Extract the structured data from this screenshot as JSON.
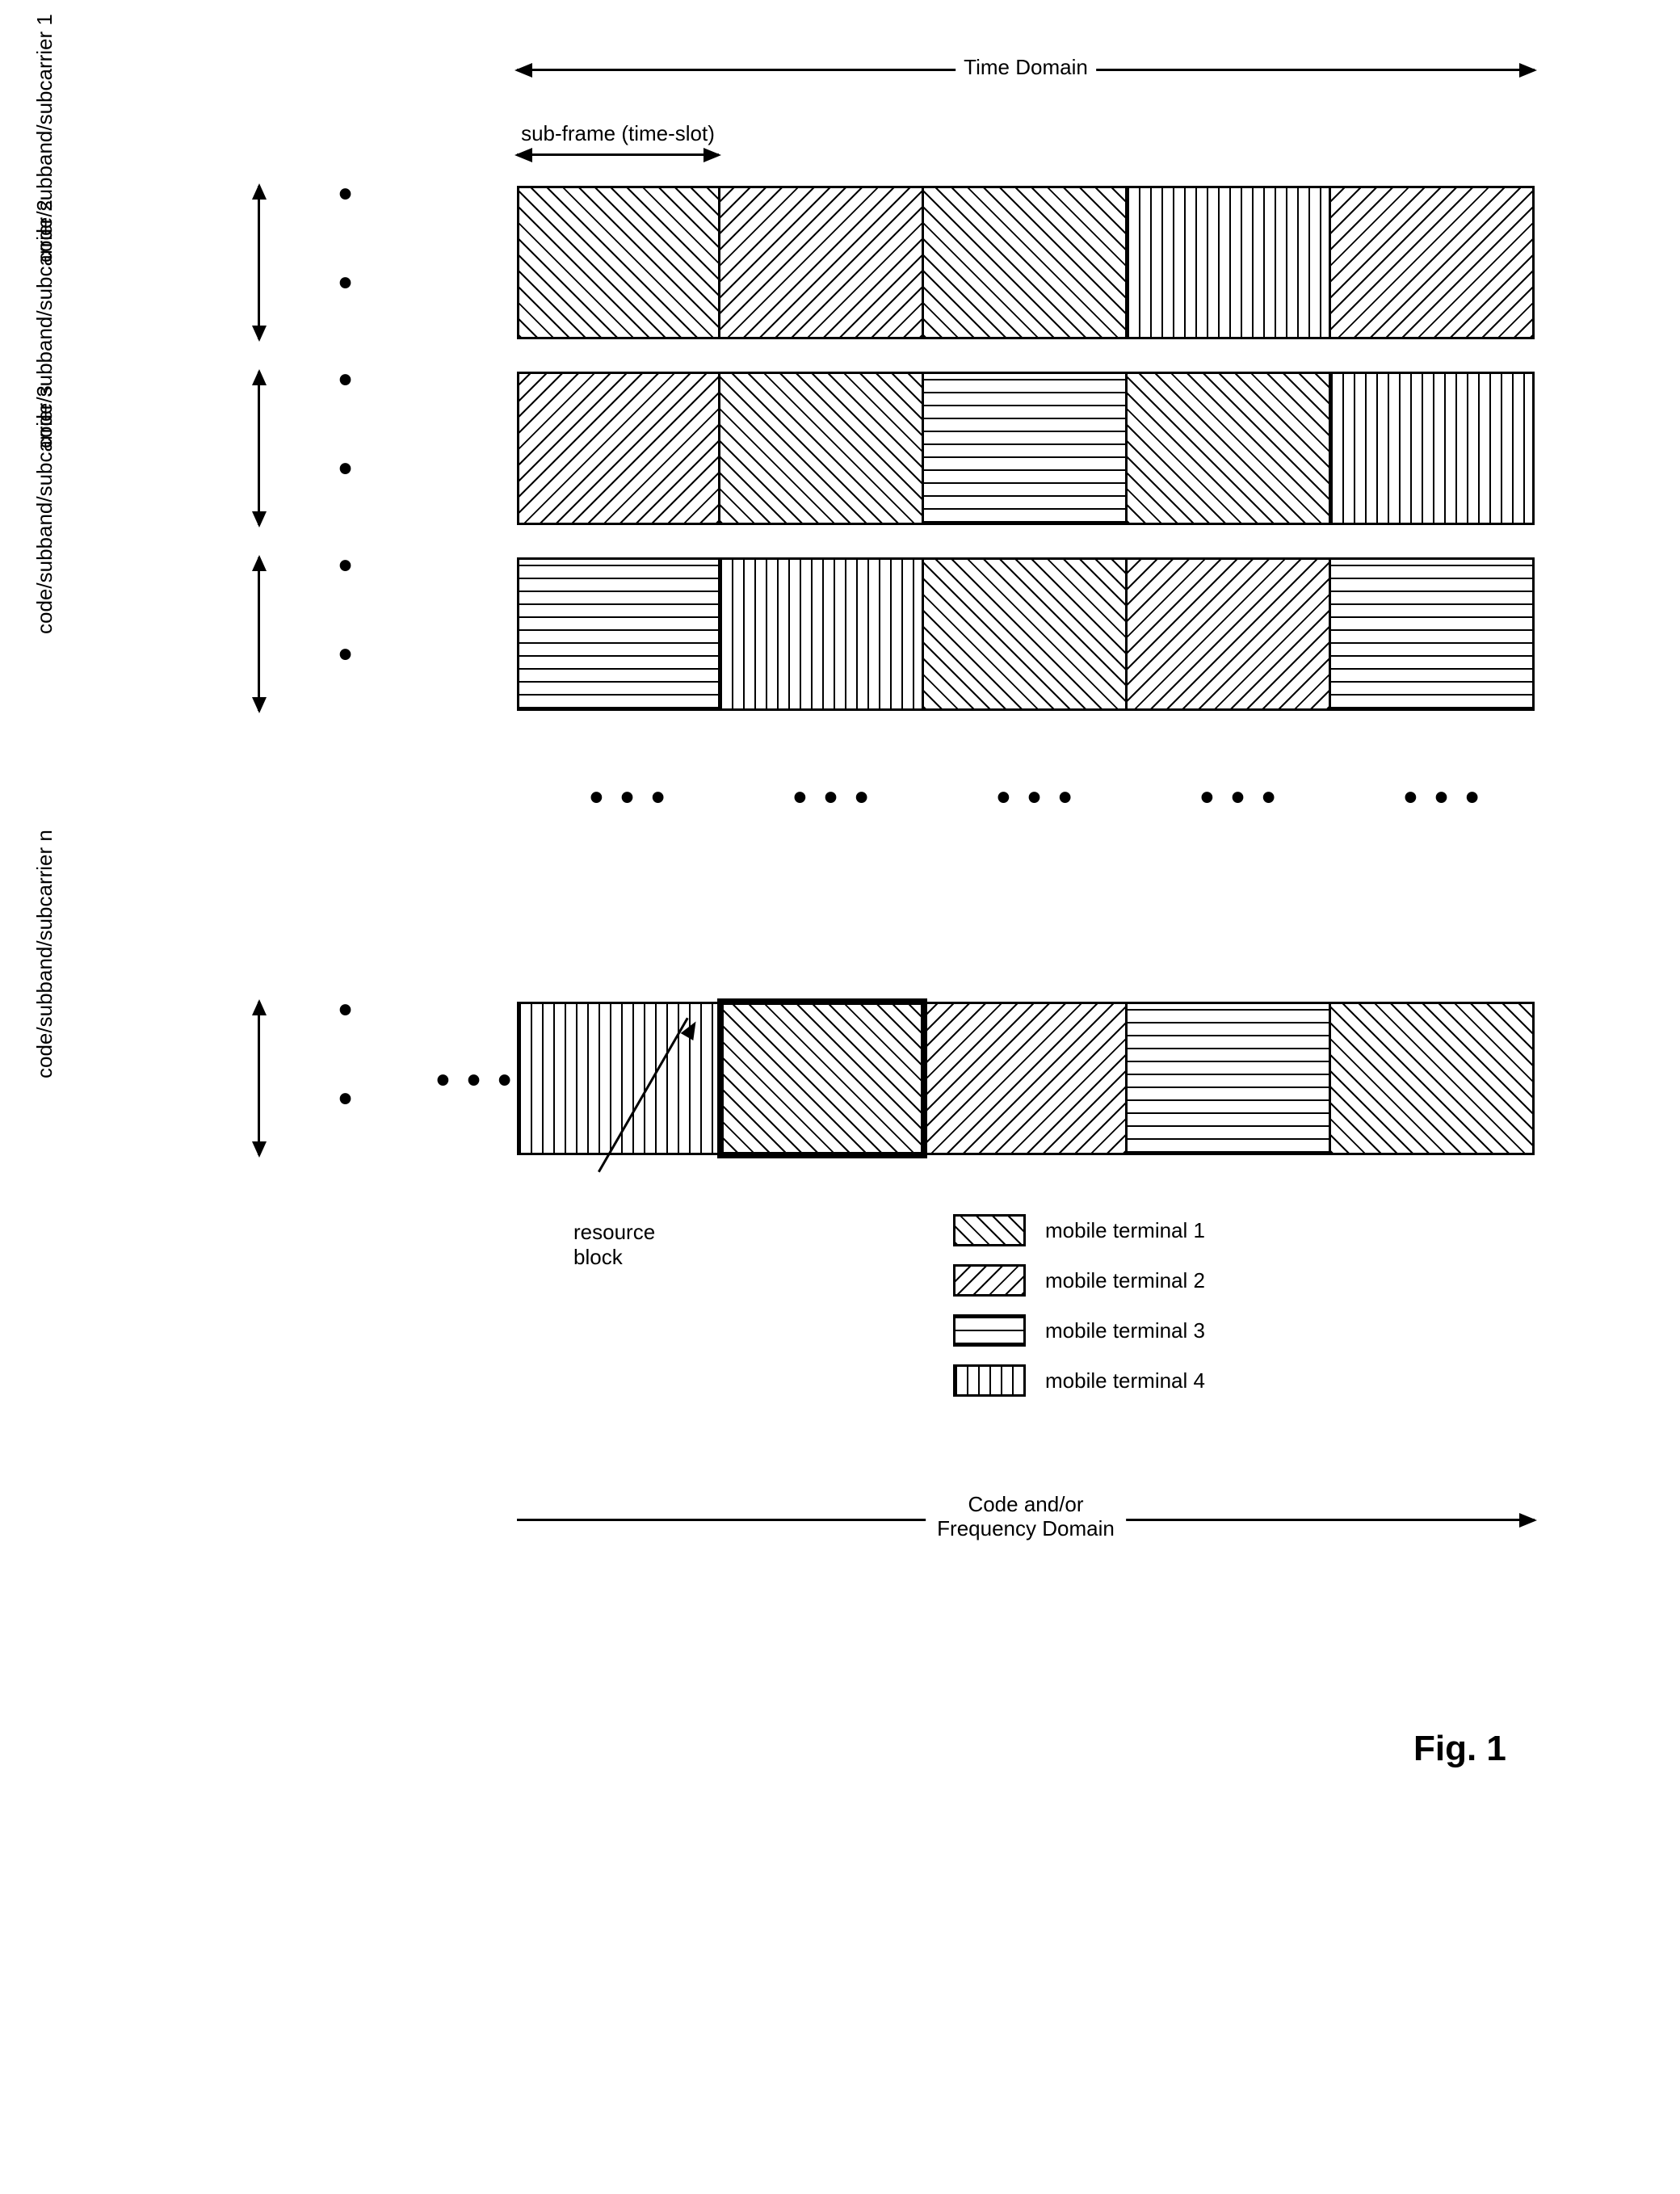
{
  "axes": {
    "time": "Time Domain",
    "subframe": "sub-frame (time-slot)",
    "freq_line1": "Code and/or",
    "freq_line2": "Frequency Domain"
  },
  "row_labels": {
    "r1": "code/subband/subcarrier 1",
    "r2": "code/subband/subcarrier 2",
    "r3": "code/subband/subcarrier 3",
    "rn": "code/subband/subcarrier n"
  },
  "legend": {
    "mt1": "mobile terminal 1",
    "mt2": "mobile terminal 2",
    "mt3": "mobile terminal 3",
    "mt4": "mobile terminal 4"
  },
  "annotation": {
    "resource_block": "resource block"
  },
  "figure_label": "Fig. 1",
  "glyph": {
    "hdots": "• • •",
    "vdots": "• •"
  },
  "chart_data": {
    "type": "table",
    "columns_represent": "sub-frames (time-slots)",
    "rows_represent": "codes / subbands / subcarriers",
    "num_visible_columns": 5,
    "num_visible_rows": 4,
    "rows": [
      "code/subband/subcarrier 1",
      "code/subband/subcarrier 2",
      "code/subband/subcarrier 3",
      "code/subband/subcarrier n"
    ],
    "cell_terminal": [
      [
        1,
        2,
        1,
        4,
        2
      ],
      [
        2,
        1,
        3,
        1,
        4
      ],
      [
        3,
        4,
        1,
        2,
        3
      ],
      [
        4,
        1,
        2,
        3,
        1
      ]
    ],
    "highlighted_cell": {
      "row_index": 3,
      "col_index": 1,
      "label": "resource block"
    },
    "terminal_legend": {
      "1": "mobile terminal 1",
      "2": "mobile terminal 2",
      "3": "mobile terminal 3",
      "4": "mobile terminal 4"
    }
  }
}
